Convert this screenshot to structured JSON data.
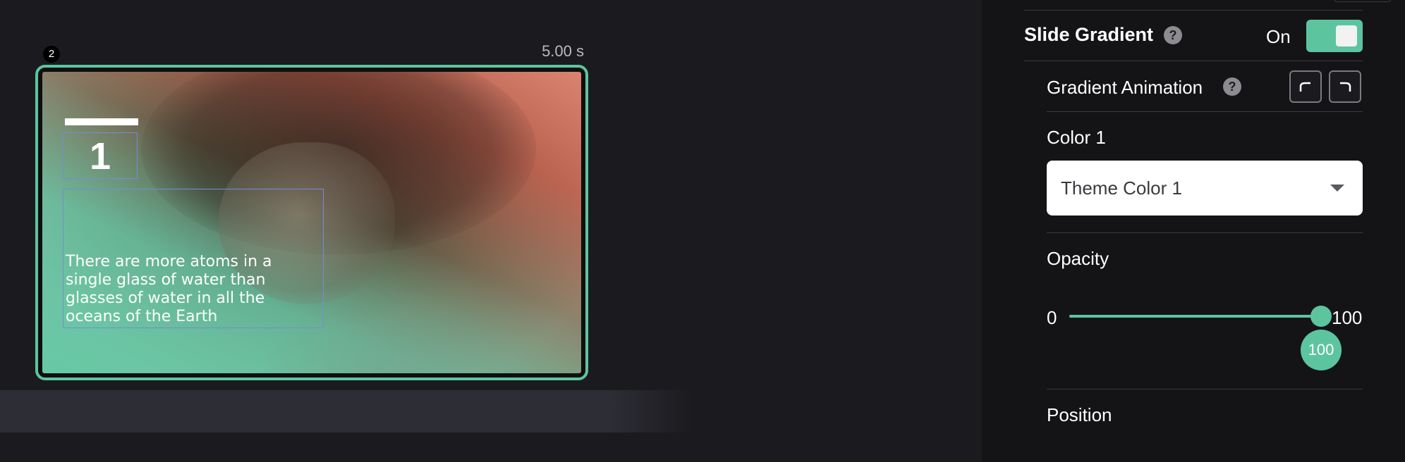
{
  "slide": {
    "index": "2",
    "duration": "5.00 s",
    "number": "1",
    "text": "There are more atoms in a single glass of water than glasses of water in all the oceans of the Earth"
  },
  "inspector": {
    "slide_gradient": {
      "title": "Slide Gradient",
      "help": "?",
      "toggle_label": "On",
      "enabled": true
    },
    "gradient_animation": {
      "label": "Gradient Animation",
      "help": "?",
      "buttons": [
        "ease-in-icon",
        "ease-out-icon"
      ]
    },
    "color1": {
      "label": "Color 1",
      "selected": "Theme Color 1"
    },
    "opacity": {
      "label": "Opacity",
      "min": "0",
      "max": "100",
      "value": "100",
      "fraction": 1.0
    },
    "position": {
      "label": "Position"
    }
  },
  "colors": {
    "accent": "#5cc5a0",
    "background": "#1b1b1f",
    "panel": "#141416"
  }
}
